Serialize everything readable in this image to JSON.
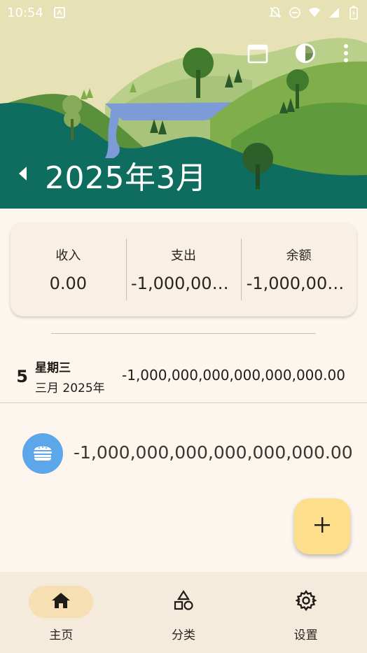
{
  "status_bar": {
    "time": "10:54",
    "icons": [
      "notification-icon",
      "bell-off-icon",
      "do-not-disturb-icon",
      "wifi-icon",
      "signal-icon",
      "battery-charging-icon"
    ]
  },
  "header": {
    "month_title": "2025年3月",
    "actions": [
      "calendar-icon",
      "pie-chart-icon",
      "more-vert-icon"
    ],
    "colors": {
      "sky": "#e8e4b8",
      "hill_dark": "#0e6d5e",
      "hill_light": "#7fad4a",
      "lake": "#7d9bd6"
    }
  },
  "summary": {
    "income_label": "收入",
    "income_value": "0.00",
    "expense_label": "支出",
    "expense_value": "-1,000,000...",
    "balance_label": "余额",
    "balance_value": "-1,000,000..."
  },
  "day": {
    "day_number": "5",
    "weekday": "星期三",
    "date": "三月 2025年",
    "total": "-1,000,000,000,000,000,000.00"
  },
  "transactions": [
    {
      "icon": "burger-icon",
      "icon_color": "#5ba7ea",
      "amount": "-1,000,000,000,000,000,000.00"
    }
  ],
  "fab": {
    "icon": "plus-icon",
    "color": "#fddf8b"
  },
  "bottom_nav": [
    {
      "label": "主页",
      "icon": "home-icon",
      "active": true
    },
    {
      "label": "分类",
      "icon": "categories-icon",
      "active": false
    },
    {
      "label": "设置",
      "icon": "settings-icon",
      "active": false
    }
  ]
}
